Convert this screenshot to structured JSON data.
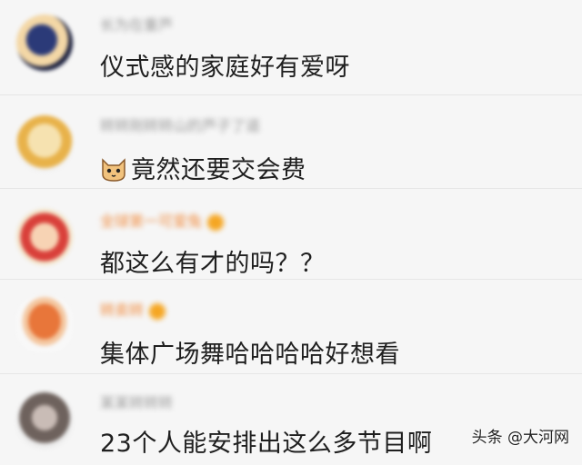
{
  "comments": [
    {
      "username": "长为在重芦",
      "text": "仪式感的家庭好有爱呀",
      "avatar_color": "#1f2a55"
    },
    {
      "username": "转转刚转转山的芦子了道",
      "text": "竟然还要交会费",
      "avatar_color": "#e8a23a",
      "emoji": "cat-face-icon"
    },
    {
      "username": "全球第一可爱兔",
      "text": "都这么有才的吗？？",
      "avatar_color": "#d9403a"
    },
    {
      "username": "转卖转",
      "text": "集体广场舞哈哈哈哈好想看",
      "avatar_color": "#e8763a"
    },
    {
      "username": "某某转转转",
      "text": "23个人能安排出这么多节目啊",
      "avatar_color": "#8a7d78"
    }
  ],
  "watermark": "头条 @大河网"
}
